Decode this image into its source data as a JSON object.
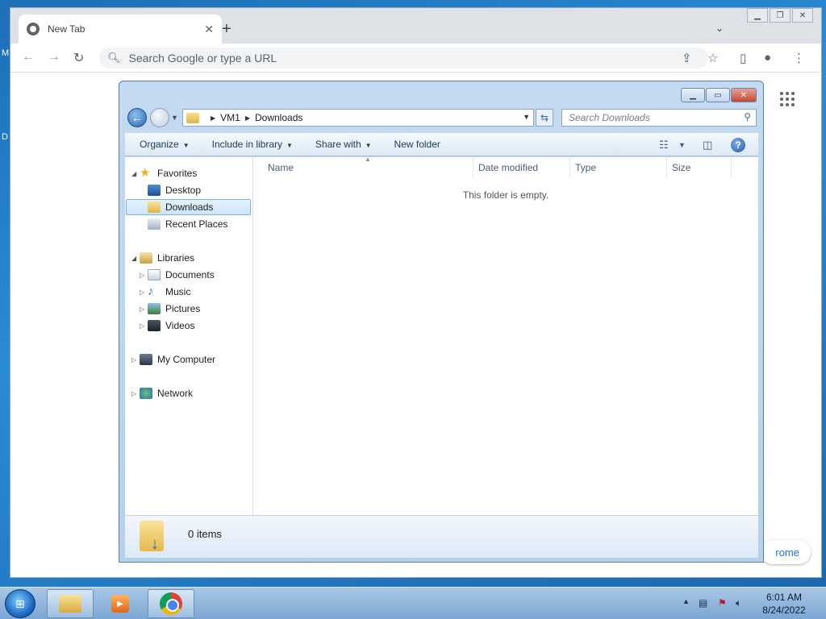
{
  "desktop": {
    "frag_top": "M",
    "frag_mid": "D"
  },
  "chrome": {
    "tab_title": "New Tab",
    "tab_close": "✕",
    "new_tab": "+",
    "tab_search": "⌄",
    "omnibox_placeholder": "Search Google or type a URL",
    "customize_label": "rome",
    "icons": [
      "back-arrow-icon",
      "forward-arrow-icon",
      "reload-icon",
      "search-icon",
      "share-icon",
      "star-icon",
      "side-panel-icon",
      "profile-icon",
      "more-menu-icon",
      "apps-grid-icon"
    ]
  },
  "explorer": {
    "breadcrumb": [
      "VM1",
      "Downloads"
    ],
    "search_placeholder": "Search Downloads",
    "commands": [
      {
        "label": "Organize",
        "dropdown": true
      },
      {
        "label": "Include in library",
        "dropdown": true
      },
      {
        "label": "Share with",
        "dropdown": true
      },
      {
        "label": "New folder",
        "dropdown": false
      }
    ],
    "nav": {
      "favorites": "Favorites",
      "desktop": "Desktop",
      "downloads": "Downloads",
      "recent": "Recent Places",
      "libraries": "Libraries",
      "documents": "Documents",
      "music": "Music",
      "pictures": "Pictures",
      "videos": "Videos",
      "computer": "My Computer",
      "network": "Network"
    },
    "columns": [
      "Name",
      "Date modified",
      "Type",
      "Size"
    ],
    "empty_message": "This folder is empty.",
    "item_count": "0 items"
  },
  "taskbar": {
    "time": "6:01 AM",
    "date": "8/24/2022"
  }
}
